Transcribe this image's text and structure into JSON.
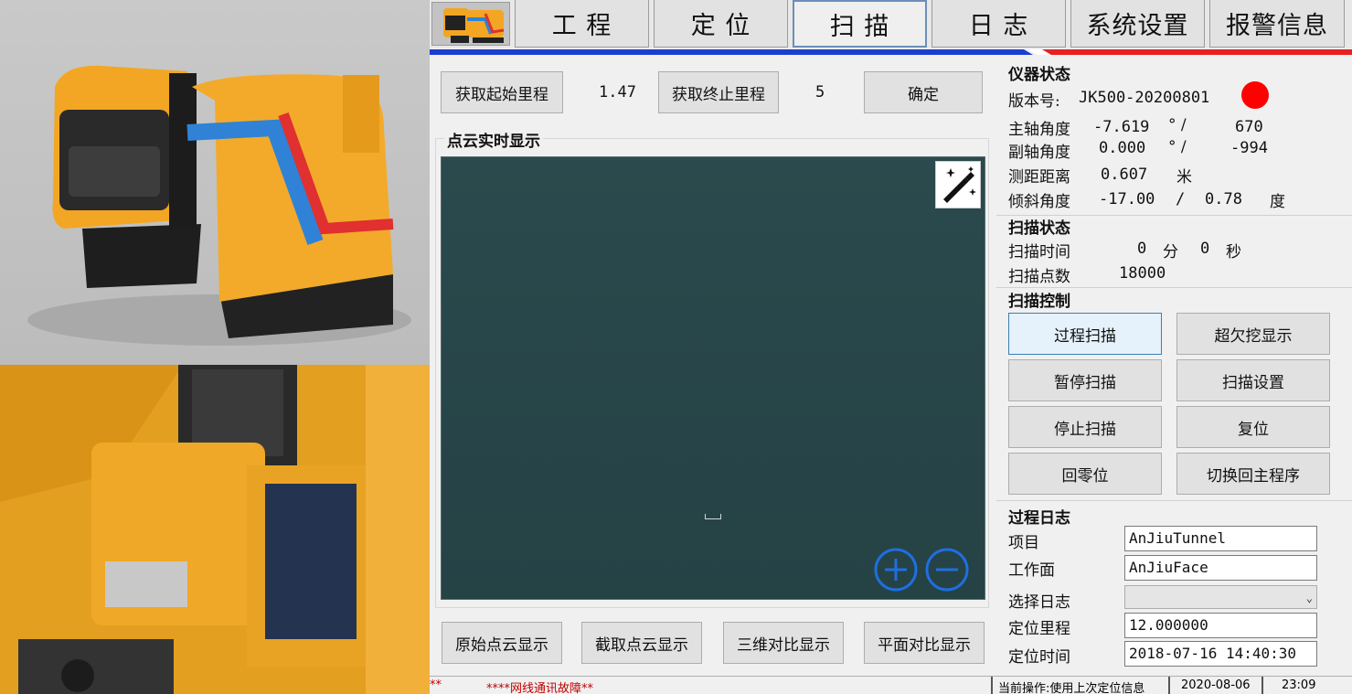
{
  "nav": {
    "tabs": [
      "工 程",
      "定 位",
      "扫 描",
      "日 志",
      "系统设置",
      "报警信息"
    ],
    "active_index": 2
  },
  "mileage": {
    "get_start_label": "获取起始里程",
    "start_value": "1.47",
    "get_end_label": "获取终止里程",
    "end_value": "5",
    "confirm_label": "确定"
  },
  "pointcloud": {
    "title": "点云实时显示",
    "bottom_buttons": [
      "原始点云显示",
      "截取点云显示",
      "三维对比显示",
      "平面对比显示"
    ]
  },
  "instrument": {
    "title": "仪器状态",
    "version_label": "版本号:",
    "version_value": "JK500-20200801",
    "status_color": "#ff0000",
    "main_axis_label": "主轴角度",
    "main_axis_value": "-7.619",
    "main_axis_unit": "° /",
    "main_axis_raw": "670",
    "sub_axis_label": "副轴角度",
    "sub_axis_value": "0.000",
    "sub_axis_unit": "° /",
    "sub_axis_raw": "-994",
    "distance_label": "测距距离",
    "distance_value": "0.607",
    "distance_unit": "米",
    "tilt_label": "倾斜角度",
    "tilt_value": "-17.00",
    "tilt_sep": "/",
    "tilt_value2": "0.78",
    "tilt_unit": "度"
  },
  "scan_status": {
    "title": "扫描状态",
    "time_label": "扫描时间",
    "minutes": "0",
    "min_unit": "分",
    "seconds": "0",
    "sec_unit": "秒",
    "points_label": "扫描点数",
    "points_value": "18000"
  },
  "scan_control": {
    "title": "扫描控制",
    "buttons": [
      "过程扫描",
      "超欠挖显示",
      "暂停扫描",
      "扫描设置",
      "停止扫描",
      "复位",
      "回零位",
      "切换回主程序"
    ]
  },
  "process_log": {
    "title": "过程日志",
    "project_label": "项目",
    "project_value": "AnJiuTunnel",
    "face_label": "工作面",
    "face_value": "AnJiuFace",
    "select_log_label": "选择日志",
    "select_log_value": "",
    "pos_mileage_label": "定位里程",
    "pos_mileage_value": "12.000000",
    "pos_time_label": "定位时间",
    "pos_time_value": "2018-07-16 14:40:30"
  },
  "status_bar": {
    "left_marks": "**",
    "alarm_text": "****网线通讯故障**",
    "current_op": "当前操作:使用上次定位信息",
    "date": "2020-08-06",
    "time": "23:09"
  }
}
